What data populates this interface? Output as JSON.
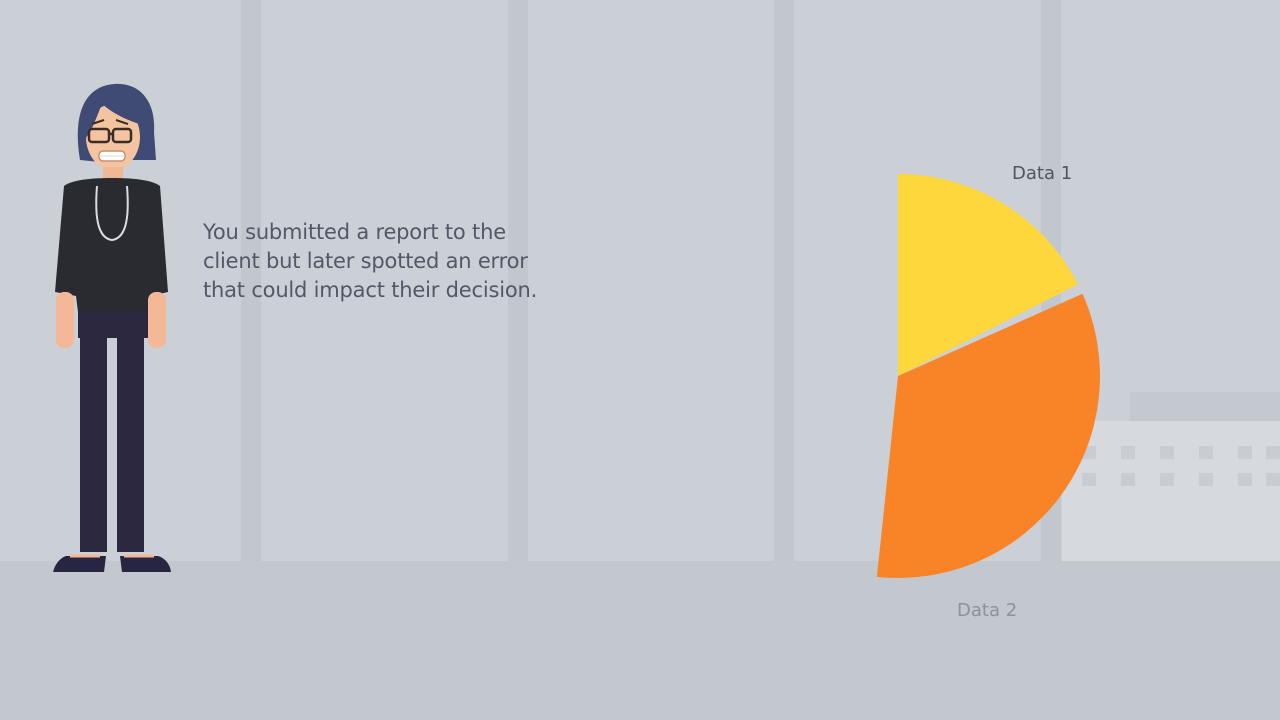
{
  "caption": {
    "lines": [
      "You submitted a report to the",
      "client but later spotted an error",
      "that could impact their decision."
    ]
  },
  "chart_data": {
    "type": "pie",
    "slices": [
      {
        "label": "Data 1",
        "color": "#fdd73b"
      },
      {
        "label": "Data 2",
        "color": "#f98428"
      }
    ]
  },
  "colors": {
    "wall": "#cbcfd6",
    "floor": "#c3c7ce",
    "pillar": "#c2c6cd",
    "slice_1": "#fdd73b",
    "slice_2": "#f98428",
    "caption_text": "#535867"
  }
}
